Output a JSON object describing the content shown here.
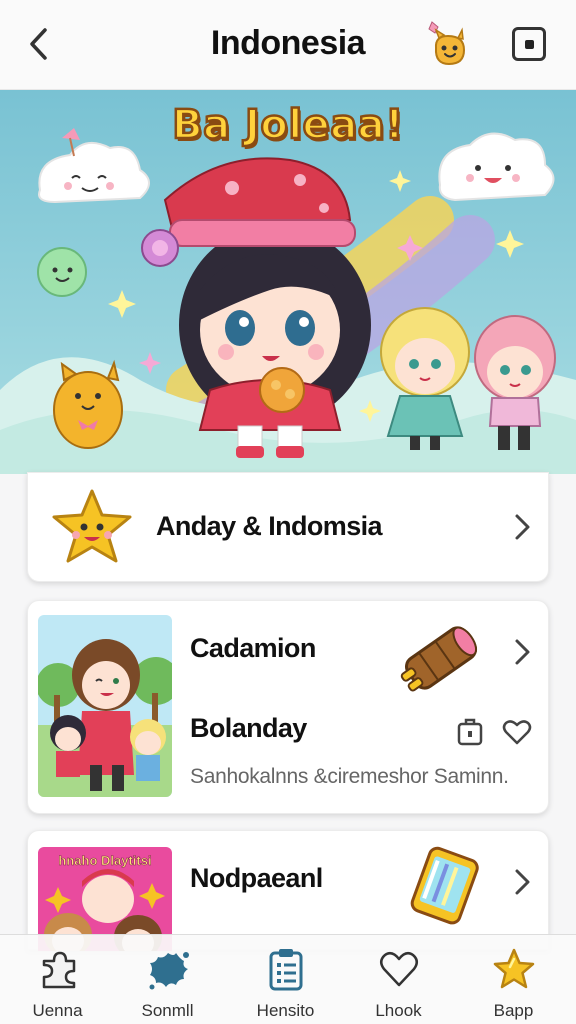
{
  "header": {
    "title": "Indonesia",
    "back_icon": "chevron-left-icon",
    "right_icon": "square-dot-icon"
  },
  "banner": {
    "title": "Ba Joleaa!"
  },
  "cards": [
    {
      "title": "Anday & Indomsia"
    },
    {
      "title": "Cadamion",
      "subtitle": "Bolanday",
      "description": "Sanhokalnns &ciremeshor Saminn."
    },
    {
      "title": "Nodpaeanl",
      "thumb_caption": "hnaho Dlaytitsi"
    }
  ],
  "bottom_nav": [
    {
      "label": "Uenna",
      "icon": "puzzle-icon"
    },
    {
      "label": "Sonmll",
      "icon": "splat-icon"
    },
    {
      "label": "Hensito",
      "icon": "clipboard-list-icon"
    },
    {
      "label": "Lhook",
      "icon": "heart-icon"
    },
    {
      "label": "Bapp",
      "icon": "star-icon"
    }
  ],
  "colors": {
    "banner_sky": "#7ec7d6",
    "banner_title": "#ffd23c",
    "accent_teal": "#2f6f8f",
    "star_yellow": "#f6c324"
  }
}
